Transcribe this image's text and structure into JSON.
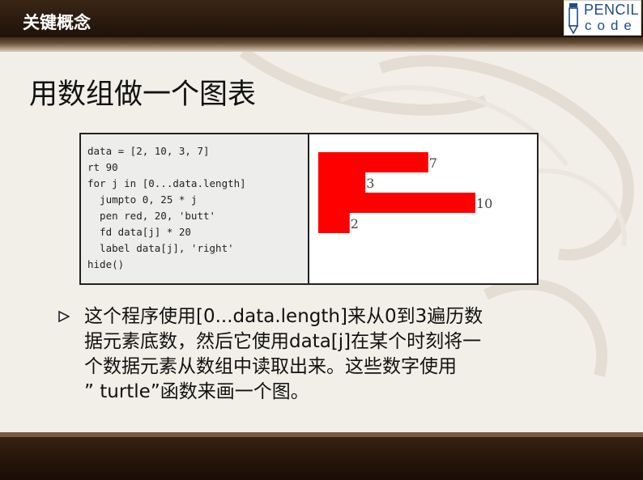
{
  "header": {
    "section_title": "关键概念"
  },
  "logo": {
    "line1": "PENCIL",
    "line2": "code"
  },
  "slide": {
    "title": "用数组做一个图表"
  },
  "code": {
    "lines": [
      "data = [2, 10, 3, 7]",
      "rt 90",
      "for j in [0...data.length]",
      "  jumpto 0, 25 * j",
      "  pen red, 20, 'butt'",
      "  fd data[j] * 20",
      "  label data[j], 'right'",
      "hide()"
    ]
  },
  "chart_data": {
    "type": "bar",
    "orientation": "horizontal",
    "categories": [
      "7",
      "3",
      "10",
      "2"
    ],
    "values": [
      7,
      3,
      10,
      2
    ],
    "data_labels": [
      "7",
      "3",
      "10",
      "2"
    ],
    "color": "#ff0000",
    "title": "",
    "xlabel": "",
    "ylabel": "",
    "xlim": [
      0,
      10
    ]
  },
  "bullet": {
    "lines": [
      "这个程序使用[0...data.length]来从0到3遍历数",
      "据元素底数，然后它使用data[j]在某个时刻将一",
      "个数据元素从数组中读取出来。这些数字使用",
      "” turtle”函数来画一个图。"
    ]
  },
  "colors": {
    "bar": "#ff0000",
    "header": "#2a1a0e",
    "background": "#f2efe9"
  }
}
